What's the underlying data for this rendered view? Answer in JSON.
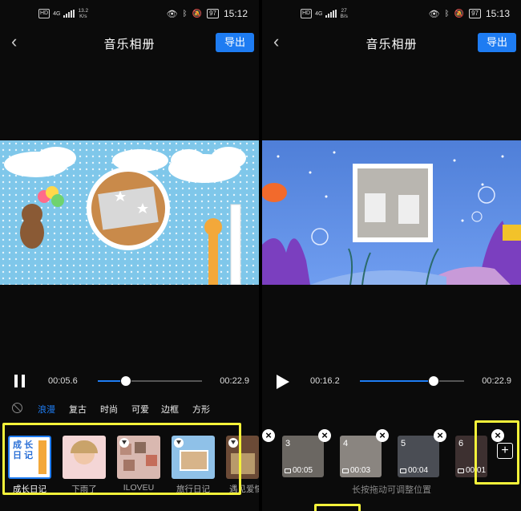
{
  "left": {
    "status": {
      "hd": "HD",
      "net": "4G",
      "speed_top": "13.2",
      "speed_bottom": "K/s",
      "battery": "97",
      "time": "15:12"
    },
    "title": "音乐相册",
    "export_label": "导出",
    "current_time": "00:05.6",
    "total_time": "00:22.9",
    "progress": 0.27,
    "style_tabs": [
      "浪漫",
      "复古",
      "时尚",
      "可爱",
      "边框",
      "方形"
    ],
    "selected_tab": "浪漫",
    "templates": [
      {
        "label": "成长日记"
      },
      {
        "label": "下雨了"
      },
      {
        "label": "ILOVEU"
      },
      {
        "label": "旅行日记"
      },
      {
        "label": "遇见爱情"
      }
    ],
    "thumb_title_chars": [
      "成",
      "长",
      "日",
      "记"
    ]
  },
  "right": {
    "status": {
      "hd": "HD",
      "net": "4G",
      "speed_top": "27",
      "speed_bottom": "B/s",
      "battery": "97",
      "time": "15:13"
    },
    "title": "音乐相册",
    "export_label": "导出",
    "current_time": "00:16.2",
    "total_time": "00:22.9",
    "progress": 0.71,
    "clips": [
      {
        "num": "3",
        "duration": "00:05"
      },
      {
        "num": "4",
        "duration": "00:03"
      },
      {
        "num": "5",
        "duration": "00:04"
      },
      {
        "num": "6",
        "duration": "00:01"
      }
    ],
    "hint": "长按拖动可调整位置",
    "add_label": "+"
  },
  "colors": {
    "accent": "#1e7cf2",
    "highlight": "#f4f23a"
  }
}
